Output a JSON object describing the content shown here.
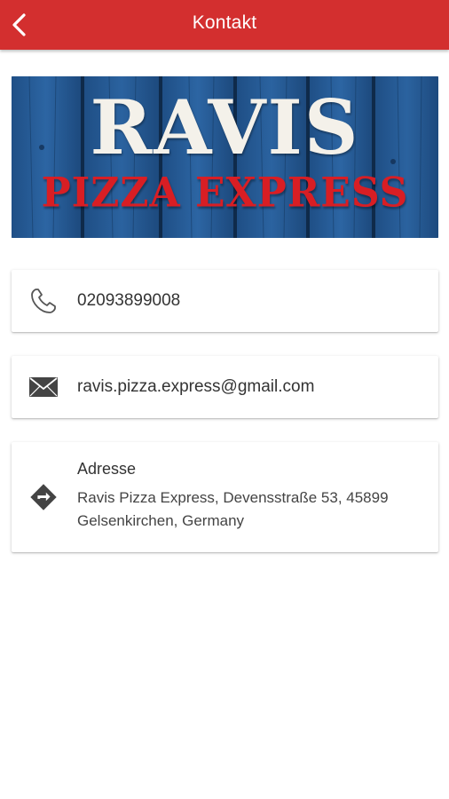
{
  "header": {
    "title": "Kontakt",
    "back_icon": "chevron-left-icon",
    "color": "#d32f2f"
  },
  "banner": {
    "logo_main": "RAVIS",
    "logo_sub": "PIZZA EXPRESS",
    "background": "blue-wood-planks"
  },
  "contact": {
    "phone": {
      "icon": "phone-icon",
      "value": "02093899008"
    },
    "email": {
      "icon": "envelope-icon",
      "value": "ravis.pizza.express@gmail.com"
    },
    "address": {
      "icon": "directions-icon",
      "label": "Adresse",
      "value": "Ravis Pizza Express, Devensstraße 53, 45899 Gelsenkirchen, Germany"
    }
  }
}
